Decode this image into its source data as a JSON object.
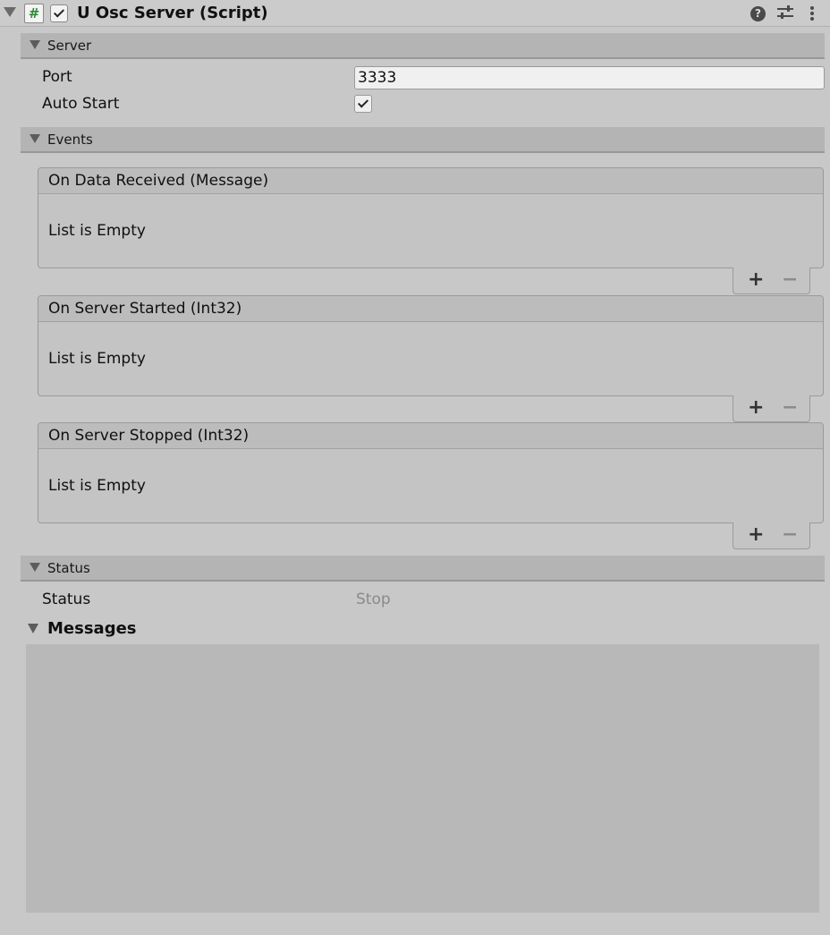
{
  "component": {
    "title": "U Osc Server (Script)",
    "script_icon_glyph": "#",
    "enabled": true,
    "help_glyph": "?"
  },
  "sections": {
    "server": "Server",
    "events": "Events",
    "status": "Status"
  },
  "server": {
    "port_label": "Port",
    "port_value": "3333",
    "auto_start_label": "Auto Start",
    "auto_start_checked": true
  },
  "events": [
    {
      "title": "On Data Received (Message)",
      "empty_text": "List is Empty"
    },
    {
      "title": "On Server Started (Int32)",
      "empty_text": "List is Empty"
    },
    {
      "title": "On Server Stopped (Int32)",
      "empty_text": "List is Empty"
    }
  ],
  "list_buttons": {
    "add": "+",
    "remove": "−"
  },
  "status": {
    "label": "Status",
    "value": "Stop"
  },
  "messages": {
    "label": "Messages"
  },
  "colors": {
    "background": "#c8c8c8",
    "section_header": "#b4b4b4",
    "script_icon_hash": "#2e8b3c",
    "status_value": "#8a8a8a"
  }
}
